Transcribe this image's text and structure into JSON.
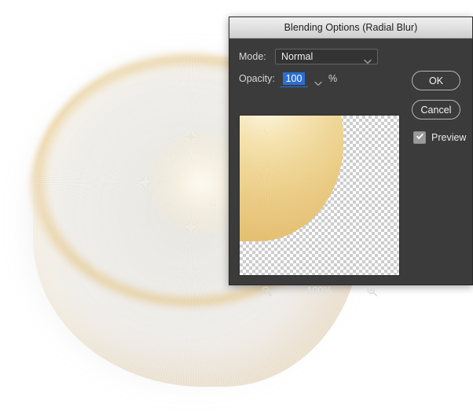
{
  "dialog": {
    "title": "Blending Options (Radial Blur)",
    "mode": {
      "label": "Mode:",
      "value": "Normal",
      "options": [
        "Normal"
      ],
      "chevron_icon": "chevron-down-icon"
    },
    "opacity": {
      "label": "Opacity:",
      "value": "100",
      "unit": "%",
      "selected": true,
      "selection_color": "#2b6ed4",
      "stepper_icon": "chevron-down-icon"
    },
    "buttons": {
      "ok": "OK",
      "cancel": "Cancel"
    },
    "preview": {
      "label": "Preview",
      "checked": true,
      "check_icon": "checkmark-icon"
    },
    "thumbnail": {
      "alt": "transparency-checkerboard-with-fur-blob-corner",
      "checker_light": "#ffffff",
      "checker_dark": "#cccccc"
    },
    "zoom": {
      "out_icon": "zoom-out-magnifier-icon",
      "in_icon": "zoom-in-magnifier-icon",
      "level": "100%"
    },
    "colors": {
      "titlebar_top": "#efefef",
      "titlebar_bottom": "#cfcfcf",
      "body": "#3b3b3b",
      "text": "#e2e2e2",
      "accent": "#2b6ed4"
    }
  },
  "canvas": {
    "artwork_name": "radial-blurred-fur-blob",
    "fur_light": "#fdf6e2",
    "fur_mid": "#e8c478",
    "fur_dark": "#d8a855",
    "background": "#ffffff"
  }
}
